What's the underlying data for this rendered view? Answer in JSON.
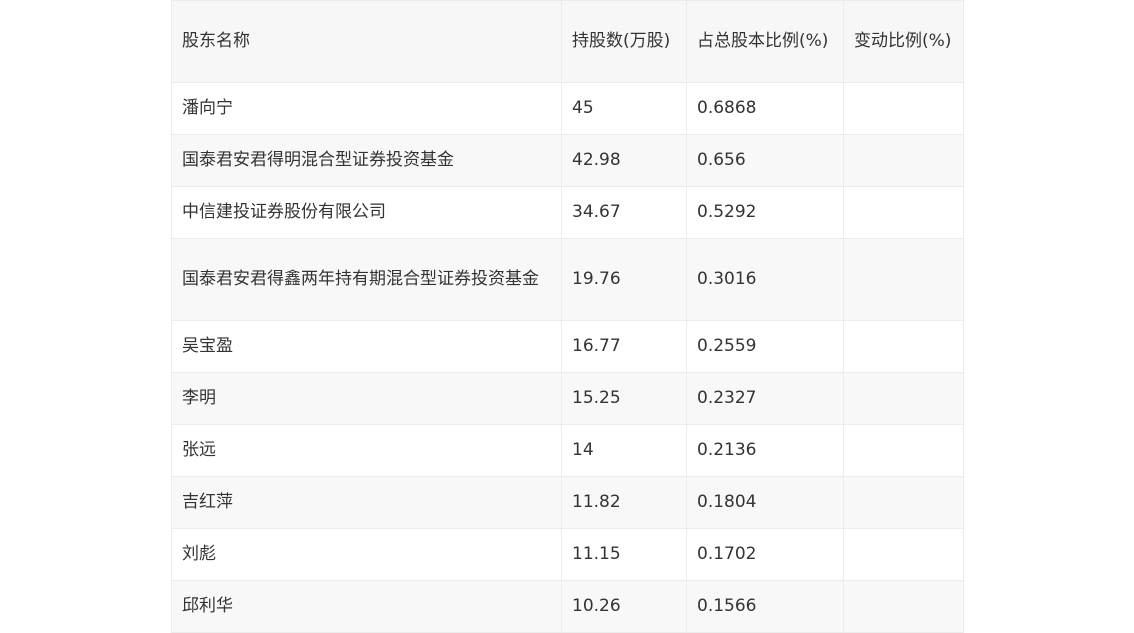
{
  "table": {
    "headers": [
      "股东名称",
      "持股数(万股)",
      "占总股本比例(%)",
      "变动比例(%)"
    ],
    "rows": [
      [
        "潘向宁",
        "45",
        "0.6868",
        ""
      ],
      [
        "国泰君安君得明混合型证券投资基金",
        "42.98",
        "0.656",
        ""
      ],
      [
        "中信建投证券股份有限公司",
        "34.67",
        "0.5292",
        ""
      ],
      [
        "国泰君安君得鑫两年持有期混合型证券投资基金",
        "19.76",
        "0.3016",
        ""
      ],
      [
        "吴宝盈",
        "16.77",
        "0.2559",
        ""
      ],
      [
        "李明",
        "15.25",
        "0.2327",
        ""
      ],
      [
        "张远",
        "14",
        "0.2136",
        ""
      ],
      [
        "吉红萍",
        "11.82",
        "0.1804",
        ""
      ],
      [
        "刘彪",
        "11.15",
        "0.1702",
        ""
      ],
      [
        "邱利华",
        "10.26",
        "0.1566",
        ""
      ]
    ]
  }
}
